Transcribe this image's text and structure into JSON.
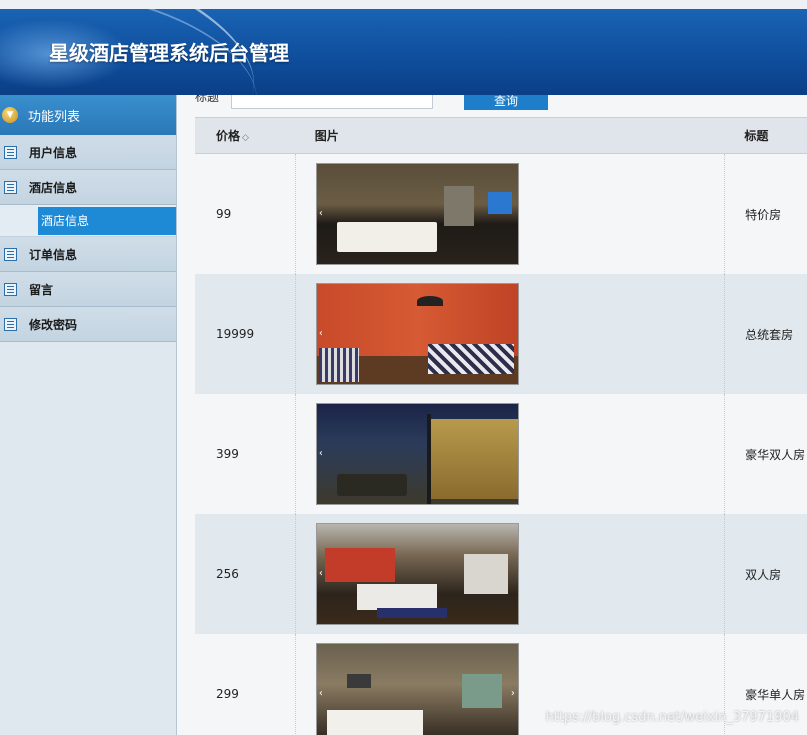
{
  "header": {
    "title": "星级酒店管理系统后台管理"
  },
  "sidebar": {
    "heading": "功能列表",
    "items": [
      {
        "label": "用户信息",
        "icon": "list-icon"
      },
      {
        "label": "酒店信息",
        "icon": "list-icon",
        "active_child": "酒店信息"
      },
      {
        "label": "订单信息",
        "icon": "list-icon"
      },
      {
        "label": "留言",
        "icon": "list-icon"
      },
      {
        "label": "修改密码",
        "icon": "list-icon"
      }
    ]
  },
  "search": {
    "label": "标题",
    "button": "查询"
  },
  "table": {
    "columns": [
      {
        "label": "价格",
        "sortable": true
      },
      {
        "label": "图片"
      },
      {
        "label": "标题"
      }
    ],
    "rows": [
      {
        "price": "99",
        "image": "hotel-room-photo-1",
        "title": "特价房"
      },
      {
        "price": "19999",
        "image": "hotel-room-photo-2",
        "title": "总统套房"
      },
      {
        "price": "399",
        "image": "hotel-room-photo-3",
        "title": "豪华双人房"
      },
      {
        "price": "256",
        "image": "hotel-room-photo-4",
        "title": "双人房"
      },
      {
        "price": "299",
        "image": "hotel-room-photo-5",
        "title": "豪华单人房"
      }
    ]
  },
  "watermark": "https://blog.csdn.net/weixin_37971904",
  "colors": {
    "banner": "#0f4f9e",
    "accent": "#1e8ad6",
    "sidebar": "#dfe8ef"
  }
}
